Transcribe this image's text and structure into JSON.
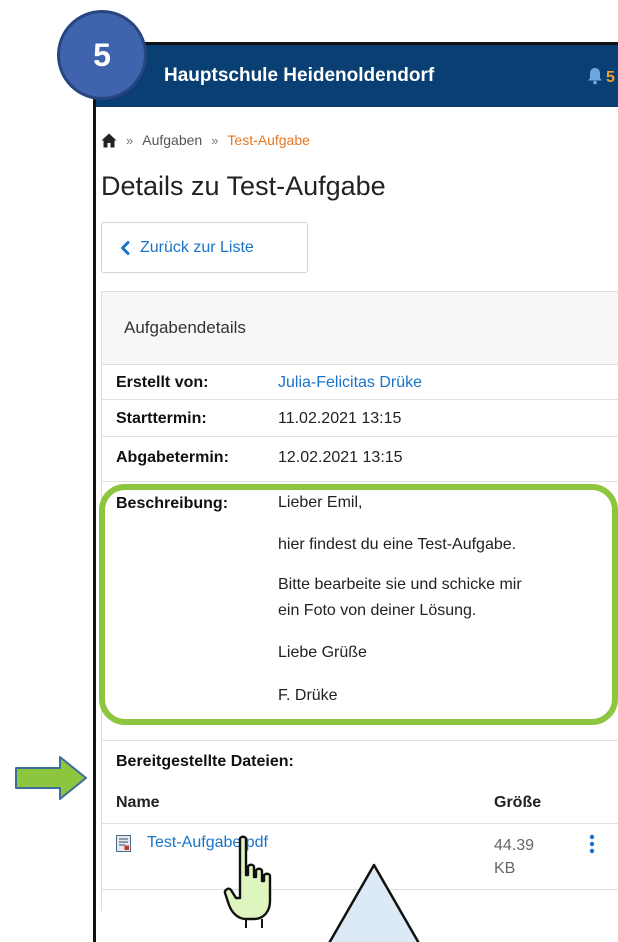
{
  "header": {
    "school_name": "Hauptschule Heidenoldendorf",
    "notification_count": "5"
  },
  "step_badge": "5",
  "breadcrumb": {
    "separator": "»",
    "items": [
      "Aufgaben"
    ],
    "current": "Test-Aufgabe"
  },
  "page_title": "Details zu Test-Aufgabe",
  "back_button_label": "Zurück zur Liste",
  "details": {
    "title": "Aufgabendetails",
    "created_by_label": "Erstellt von:",
    "created_by": "Julia-Felicitas Drüke",
    "start_label": "Starttermin:",
    "start": "11.02.2021 13:15",
    "due_label": "Abgabetermin:",
    "due": "12.02.2021 13:15",
    "description_label": "Beschreibung:",
    "description": [
      "Lieber Emil,",
      "hier findest du eine Test-Aufgabe.",
      "Bitte bearbeite sie und schicke mir",
      "ein Foto von deiner Lösung.",
      "Liebe Grüße",
      "F. Drüke"
    ]
  },
  "files": {
    "heading": "Bereitgestellte Dateien:",
    "col_name": "Name",
    "col_size": "Größe",
    "items": [
      {
        "name": "Test-Aufgabe.pdf",
        "size": "44.39 KB"
      }
    ]
  },
  "colors": {
    "header_bg": "#0a3f73",
    "link": "#1a73c9",
    "accent_orange": "#e87722",
    "highlight_green": "#8cc63f",
    "badge_blue": "#3f64ad"
  },
  "icons": [
    "home-icon",
    "bell-icon",
    "chevron-left-icon",
    "pdf-file-icon",
    "more-vertical-icon",
    "hand-pointer-icon",
    "arrow-right-icon"
  ]
}
